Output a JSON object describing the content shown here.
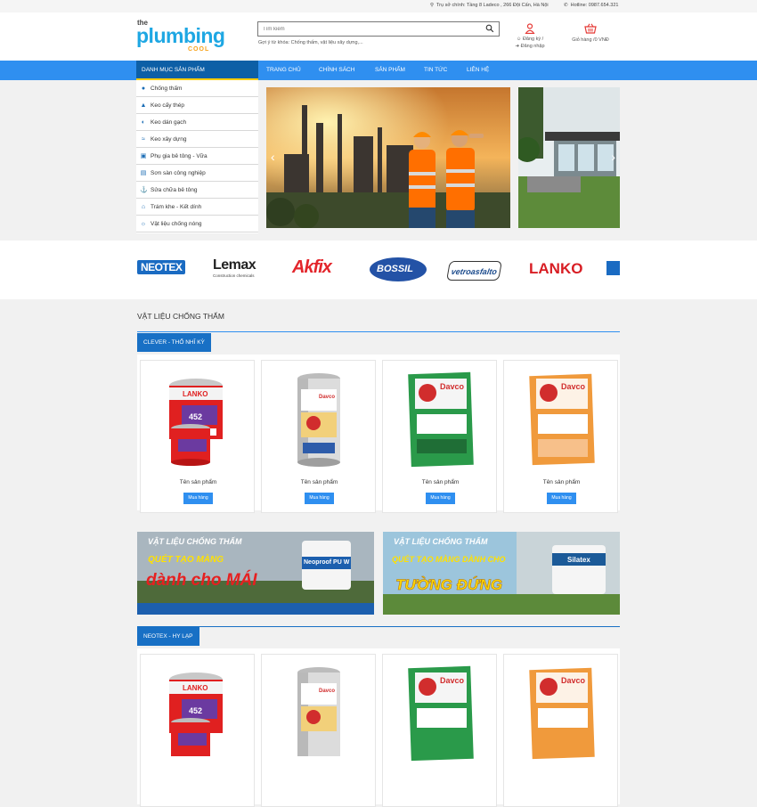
{
  "topbar": {
    "address": "Trụ sở chính: Tầng 8 Ladeco , 266 Đội Cấn, Hà Nội",
    "hotline": "Hotline: 0987.654.321"
  },
  "header": {
    "logo_the": "the",
    "logo_plumbing": "plumbing",
    "logo_cool": "COOL",
    "search_placeholder": "Tìm kiếm",
    "search_hint": "Gợi ý từ khóa: Chống thấm, vật liệu xây dựng,...",
    "register": "Đăng ký /",
    "login": "Đăng nhập",
    "cart": "Giỏ hàng /0 VNĐ"
  },
  "nav": {
    "category_label": "DANH MỤC SẢN PHẨM",
    "items": [
      "TRANG CHỦ",
      "CHÍNH SÁCH",
      "SẢN PHẨM",
      "TIN TỨC",
      "LIÊN HỆ"
    ]
  },
  "sidebar": {
    "items": [
      {
        "label": "Chống thấm",
        "icon": "drop-icon"
      },
      {
        "label": "Keo cấy thép",
        "icon": "mountain-icon"
      },
      {
        "label": "Keo dán gạch",
        "icon": "half-circle-icon"
      },
      {
        "label": "Keo xây dựng",
        "icon": "wave-icon"
      },
      {
        "label": "Phụ gia bê tông - Vữa",
        "icon": "mixer-icon"
      },
      {
        "label": "Sơn sàn công nghiệp",
        "icon": "roller-icon"
      },
      {
        "label": "Sửa chữa bê tông",
        "icon": "anchor-icon"
      },
      {
        "label": "Trám khe - Kết dính",
        "icon": "gate-icon"
      },
      {
        "label": "Vật liệu chống nóng",
        "icon": "sun-icon"
      }
    ]
  },
  "brands": [
    "NEOTEX",
    "Lemax",
    "Construction chemicals",
    "Akfix",
    "BOSSIL",
    "vetroasfalto",
    "LANKO"
  ],
  "section": {
    "title": "VẬT LIỆU CHỐNG THẤM",
    "group1": "CLEVER - THỔ NHĨ KỲ",
    "group2": "NEOTEX - HY LẠP"
  },
  "products": [
    {
      "name": "Tên sản phẩm",
      "buy": "Mua hàng",
      "brand": "LANKO",
      "code": "452"
    },
    {
      "name": "Tên sản phẩm",
      "buy": "Mua hàng",
      "brand": "Davco"
    },
    {
      "name": "Tên sản phẩm",
      "buy": "Mua hàng",
      "brand": "Davco"
    },
    {
      "name": "Tên sản phẩm",
      "buy": "Mua hàng",
      "brand": "Davco"
    }
  ],
  "promos": [
    {
      "line1": "VẬT LIỆU CHỐNG THẤM",
      "line2": "QUÉT TẠO MÀNG",
      "line3": "dành cho MÁI",
      "product": "Neoproof PU W"
    },
    {
      "line1": "VẬT LIỆU CHỐNG THẤM",
      "line2": "QUÉT TẠO MÀNG DÀNH CHO",
      "line3": "TƯỜNG ĐỨNG",
      "product": "Silatex"
    }
  ],
  "colors": {
    "nav_blue": "#2f8ff0",
    "dark_blue": "#0d5fa6",
    "tab_blue": "#1870c5",
    "logo_blue": "#1ea7e3",
    "logo_orange": "#f7a31c"
  }
}
